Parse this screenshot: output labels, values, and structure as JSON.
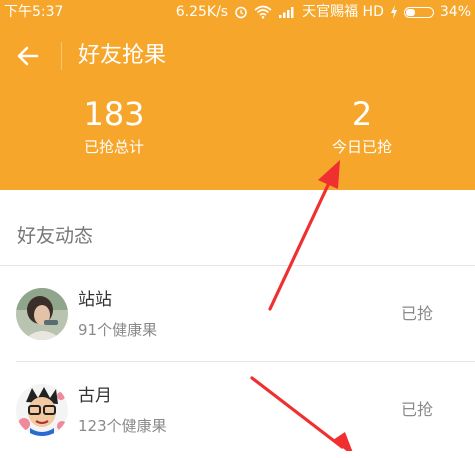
{
  "status_bar": {
    "time": "下午5:37",
    "speed": "6.25K/s",
    "carrier": "天官赐福 HD",
    "battery": "34%",
    "battery_level": 0.34
  },
  "header": {
    "title": "好友抢果",
    "back_icon": "back-arrow-icon",
    "stats": [
      {
        "value": "183",
        "label": "已抢总计"
      },
      {
        "value": "2",
        "label": "今日已抢"
      }
    ]
  },
  "section": {
    "title": "好友动态"
  },
  "friends": [
    {
      "name": "站站",
      "count": "91个健康果",
      "status": "已抢"
    },
    {
      "name": "古月",
      "count": "123个健康果",
      "status": "已抢"
    }
  ],
  "colors": {
    "brand": "#f6a72b",
    "annotation_arrow": "#f03030"
  }
}
